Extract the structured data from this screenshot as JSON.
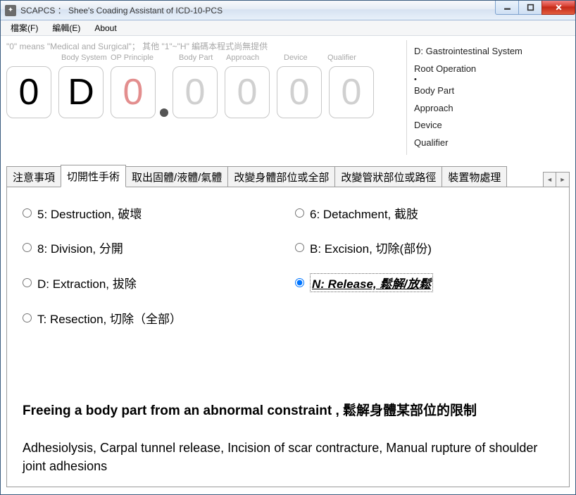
{
  "window": {
    "title": "SCAPCS ： Shee's Coading Assistant of ICD-10-PCS"
  },
  "menu": {
    "file": "檔案(F)",
    "edit": "編輯(E)",
    "about": "About"
  },
  "hint": "\"0\" means \"Medical and Surgical\"； 其他 \"1\"~\"H\" 編碼本程式尚無提供",
  "col_labels": {
    "body_system": "Body System",
    "op_principle": "OP Principle",
    "body_part": "Body Part",
    "approach": "Approach",
    "device": "Device",
    "qualifier": "Qualifier"
  },
  "code": {
    "c1": "0",
    "c2": "D",
    "c3": "0",
    "c4": "0",
    "c5": "0",
    "c6": "0",
    "c7": "0"
  },
  "info": {
    "line1": "D: Gastrointestinal System",
    "root_op": "Root Operation",
    "body_part": "Body Part",
    "approach": "Approach",
    "device": "Device",
    "qualifier": "Qualifier"
  },
  "tabs": {
    "t1": "注意事項",
    "t2": "切開性手術",
    "t3": "取出固體/液體/氣體",
    "t4": "改變身體部位或全部",
    "t5": "改變管狀部位或路徑",
    "t6": "裝置物處理"
  },
  "options": {
    "o5": "5: Destruction, 破壞",
    "o6": "6: Detachment, 截肢",
    "o8": "8: Division, 分開",
    "oB": "B: Excision, 切除(部份)",
    "oD": "D: Extraction, 拔除",
    "oN": "N: Release, 鬆解/放鬆",
    "oT": "T: Resection, 切除（全部）"
  },
  "desc": {
    "title": "Freeing a body part from an abnormal constraint , 鬆解身體某部位的限制",
    "examples": "Adhesiolysis, Carpal tunnel release, Incision of scar contracture, Manual rupture of shoulder joint adhesions"
  }
}
